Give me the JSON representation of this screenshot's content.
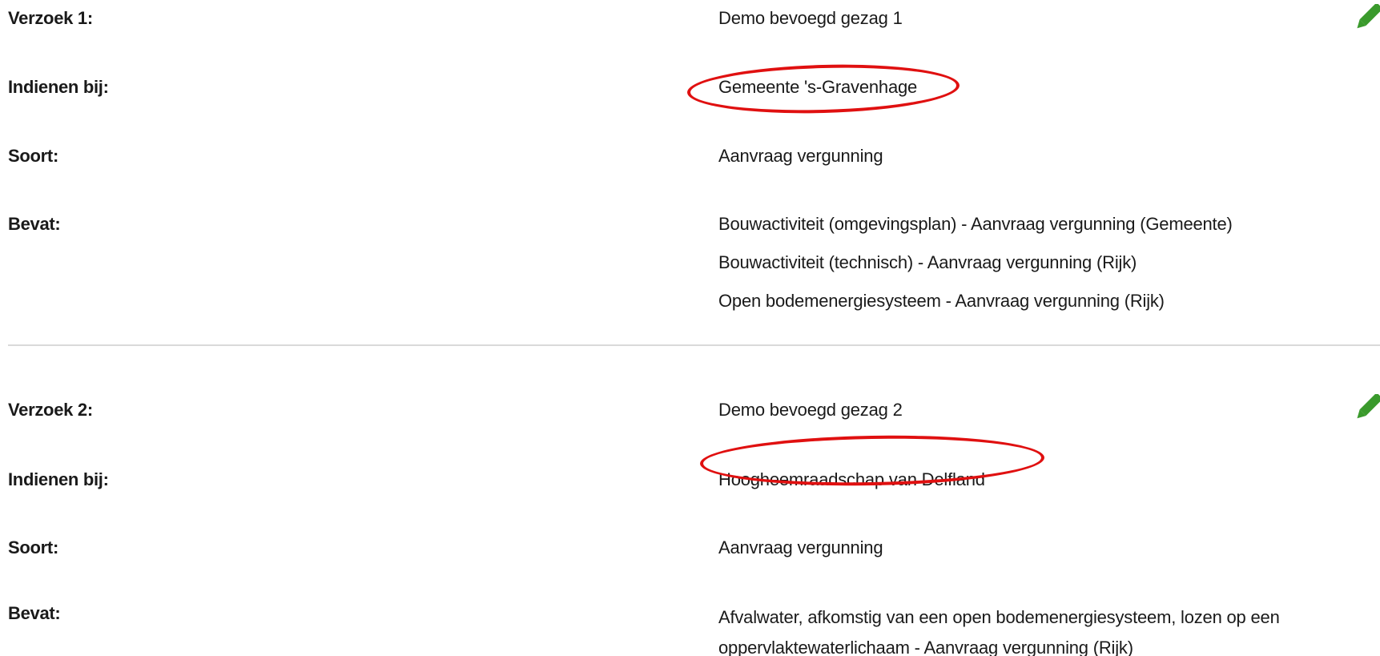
{
  "requests": [
    {
      "title_label": "Verzoek 1:",
      "title_value": "Demo bevoegd gezag 1",
      "submit_label": "Indienen bij:",
      "submit_value": "Gemeente 's-Gravenhage",
      "type_label": "Soort:",
      "type_value": "Aanvraag vergunning",
      "contains_label": "Bevat:",
      "contains_items": [
        "Bouwactiviteit (omgevingsplan) - Aanvraag vergunning (Gemeente)",
        "Bouwactiviteit (technisch) - Aanvraag vergunning (Rijk)",
        "Open bodemenergiesysteem - Aanvraag vergunning (Rijk)"
      ],
      "edit_icon": "pencil-icon"
    },
    {
      "title_label": "Verzoek 2:",
      "title_value": "Demo bevoegd gezag 2",
      "submit_label": "Indienen bij:",
      "submit_value": "Hoogheemraadschap van Delfland",
      "type_label": "Soort:",
      "type_value": "Aanvraag vergunning",
      "contains_label": "Bevat:",
      "contains_items": [
        "Afvalwater, afkomstig van een open bodemenergiesysteem, lozen op een oppervlaktewaterlichaam - Aanvraag vergunning (Rijk)"
      ],
      "edit_icon": "pencil-icon"
    }
  ],
  "colors": {
    "text": "#1a1a1a",
    "edit_icon": "#3a9a2c",
    "annotation": "#e01010",
    "divider": "#d9d9d9"
  }
}
